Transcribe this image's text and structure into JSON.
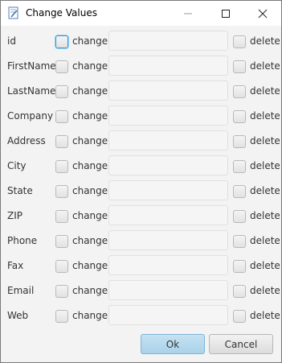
{
  "window": {
    "title": "Change Values",
    "controls": {
      "minimize": "minimize",
      "maximize": "maximize",
      "close": "close"
    }
  },
  "form": {
    "change_label": "change",
    "delete_label": "delete",
    "rows": [
      {
        "label": "id"
      },
      {
        "label": "FirstName"
      },
      {
        "label": "LastName"
      },
      {
        "label": "Company"
      },
      {
        "label": "Address"
      },
      {
        "label": "City"
      },
      {
        "label": "State"
      },
      {
        "label": "ZIP"
      },
      {
        "label": "Phone"
      },
      {
        "label": "Fax"
      },
      {
        "label": "Email"
      },
      {
        "label": "Web"
      }
    ]
  },
  "buttons": {
    "ok": "Ok",
    "cancel": "Cancel"
  },
  "colors": {
    "ok_button": "#b8dbef",
    "focus_ring": "#3a98d4"
  }
}
